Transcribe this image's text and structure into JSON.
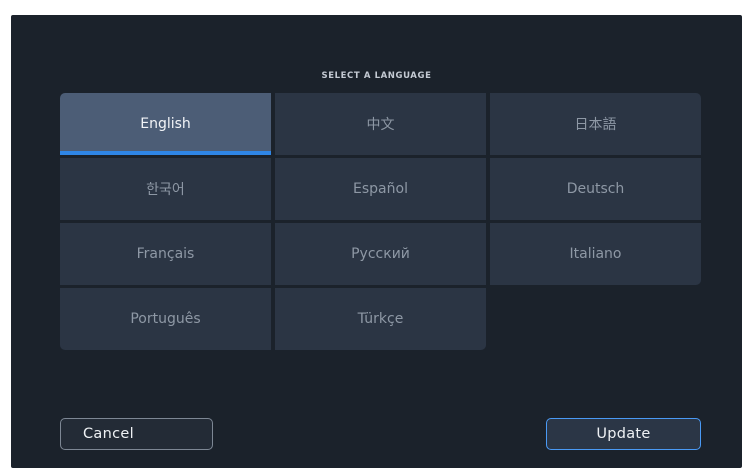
{
  "dialog": {
    "heading": "SELECT A LANGUAGE",
    "selected_language": "English"
  },
  "languages": [
    {
      "label": "English"
    },
    {
      "label": "中文"
    },
    {
      "label": "日本語"
    },
    {
      "label": "한국어"
    },
    {
      "label": "Español"
    },
    {
      "label": "Deutsch"
    },
    {
      "label": "Français"
    },
    {
      "label": "Русский"
    },
    {
      "label": "Italiano"
    },
    {
      "label": "Português"
    },
    {
      "label": "Türkçe"
    }
  ],
  "buttons": {
    "cancel_label": "Cancel",
    "update_label": "Update"
  },
  "colors": {
    "background": "#1b222b",
    "tile": "#2b3544",
    "tile_selected": "#4c5d76",
    "selection_accent": "#2f86e6",
    "update_border": "#4a9af5"
  }
}
